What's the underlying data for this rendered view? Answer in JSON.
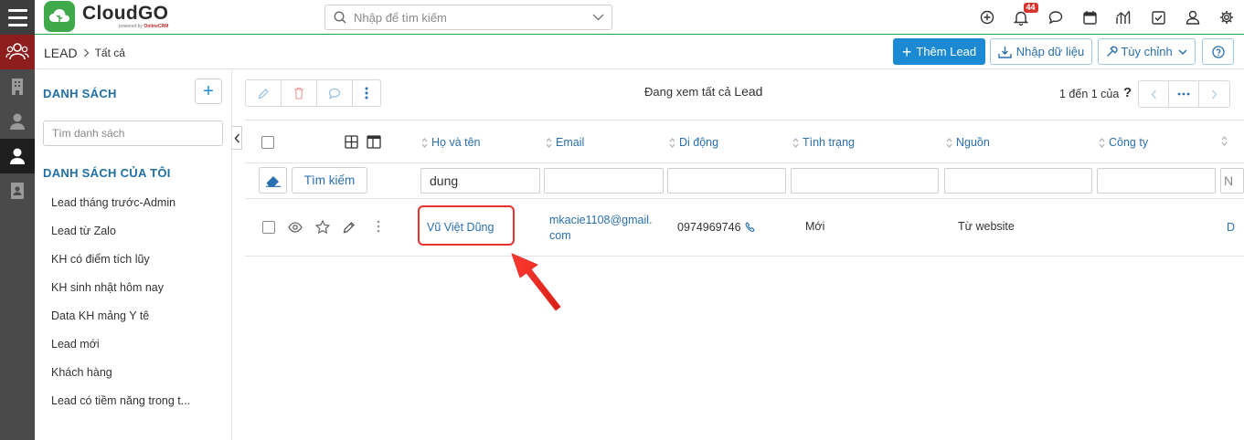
{
  "app": {
    "name": "CloudGO",
    "powered": "powered by",
    "powered_brand": "OnlineCRM"
  },
  "search": {
    "placeholder": "Nhập để tìm kiếm"
  },
  "notifications": {
    "count": "44"
  },
  "breadcrumb": {
    "module": "LEAD",
    "view": "Tất cả"
  },
  "header_buttons": {
    "add_lead": "Thêm Lead",
    "import": "Nhập dữ liệu",
    "customize": "Tùy chỉnh"
  },
  "sidebar": {
    "title": "DANH SÁCH",
    "search_placeholder": "Tìm danh sách",
    "my_lists_title": "DANH SÁCH CỦA TÔI",
    "items": [
      "Lead tháng trước-Admin",
      "Lead từ Zalo",
      "KH có điểm tích lũy",
      "KH sinh nhật hôm nay",
      "Data KH mảng Y tê",
      "Lead mới",
      "Khách hàng",
      "Lead có tiềm năng trong t..."
    ]
  },
  "main": {
    "viewing_prefix": "Đang xem tất cả",
    "viewing_module": "Lead",
    "pagination": "1 đến 1 của",
    "pagination_q": "?"
  },
  "columns": [
    "Họ và tên",
    "Email",
    "Di động",
    "Tình trạng",
    "Nguồn",
    "Công ty"
  ],
  "filters": {
    "search_button": "Tìm kiếm",
    "name_value": "dung",
    "last_placeholder": "N"
  },
  "rows": [
    {
      "name": "Vũ Việt Dũng",
      "email_line1": "mkacie1108@gmail.",
      "email_line2": "com",
      "mobile": "0974969746",
      "status": "Mới",
      "source": "Từ website",
      "company": "D"
    }
  ],
  "colors": {
    "accent": "#1b8ad3",
    "brand_green": "#3eaa49",
    "highlight": "#e8312b"
  }
}
